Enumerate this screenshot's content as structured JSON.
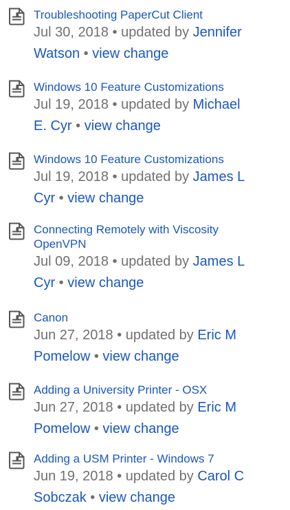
{
  "activity": {
    "updated_by_text": " updated by ",
    "separator": "•",
    "items": [
      {
        "title": "Troubleshooting PaperCut Client",
        "date": "Jul 30, 2018",
        "author_line1": "Jennifer",
        "author_line2": "Watson",
        "view_change": "view change"
      },
      {
        "title": "Windows 10 Feature Customizations",
        "date": "Jul 19, 2018",
        "author_line1": "Michael",
        "author_line2": "E. Cyr",
        "view_change": "view change"
      },
      {
        "title": "Windows 10 Feature Customizations",
        "date": "Jul 19, 2018",
        "author_line1": "James L",
        "author_line2": "Cyr",
        "view_change": "view change"
      },
      {
        "title_line1": "Connecting Remotely with Viscosity",
        "title_line2": "OpenVPN",
        "date": "Jul 09, 2018",
        "author_line1": "James L",
        "author_line2": "Cyr",
        "view_change": "view change"
      },
      {
        "title": "Canon",
        "date": "Jun 27, 2018",
        "author_line1": "Eric M",
        "author_line2": "Pomelow",
        "view_change": "view change"
      },
      {
        "title": "Adding a University Printer - OSX",
        "date": "Jun 27, 2018",
        "author_line1": "Eric M",
        "author_line2": "Pomelow",
        "view_change": "view change"
      },
      {
        "title": "Adding a USM Printer - Windows 7",
        "date": "Jun 19, 2018",
        "author_line1": "Carol C",
        "author_line2": "Sobczak",
        "view_change": "view change"
      }
    ]
  },
  "colors": {
    "link": "#1a57bf",
    "meta_text": "#707070",
    "icon_stroke": "#555555"
  },
  "icons": {
    "entry_icon": "document-icon"
  }
}
